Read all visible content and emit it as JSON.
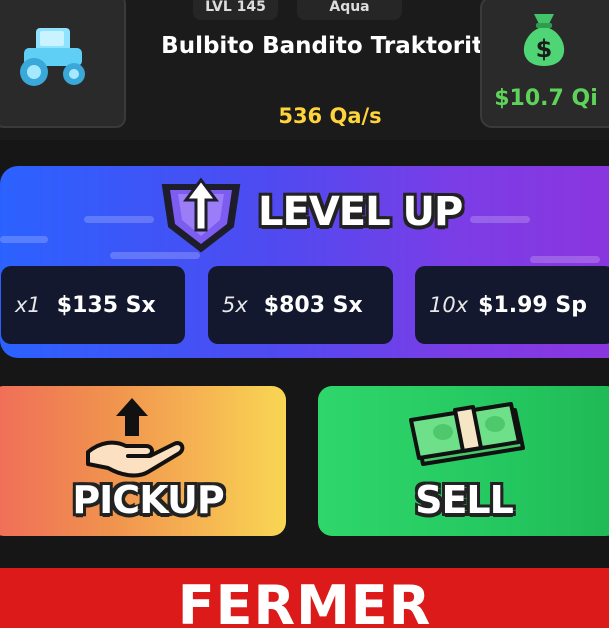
{
  "pet": {
    "level": "LVL 145",
    "mutation": "Aqua",
    "name": "Bulbito Bandito Traktorito",
    "rate": "536 Qa/s",
    "thumbnail_icon": "aqua-tractor-icon"
  },
  "wallet": {
    "balance": "$10.7 Qi",
    "icon": "money-bag-icon",
    "accent": "#5ed35a"
  },
  "level_up": {
    "title": "LEVEL UP",
    "icon": "up-arrow-shield-icon",
    "options": [
      {
        "multiplier": "x1",
        "cost": "$135 Sx"
      },
      {
        "multiplier": "5x",
        "cost": "$803 Sx"
      },
      {
        "multiplier": "10x",
        "cost": "$1.99 Sp"
      }
    ]
  },
  "actions": {
    "pickup_label": "PICKUP",
    "pickup_icon": "hand-pickup-icon",
    "sell_label": "SELL",
    "sell_icon": "cash-stack-icon"
  },
  "banner": {
    "text": "FERMER"
  },
  "colors": {
    "rate": "#ffd43b",
    "level_panel": "#4f4af0",
    "sell": "#25c860",
    "banner": "#dc1a1a"
  }
}
